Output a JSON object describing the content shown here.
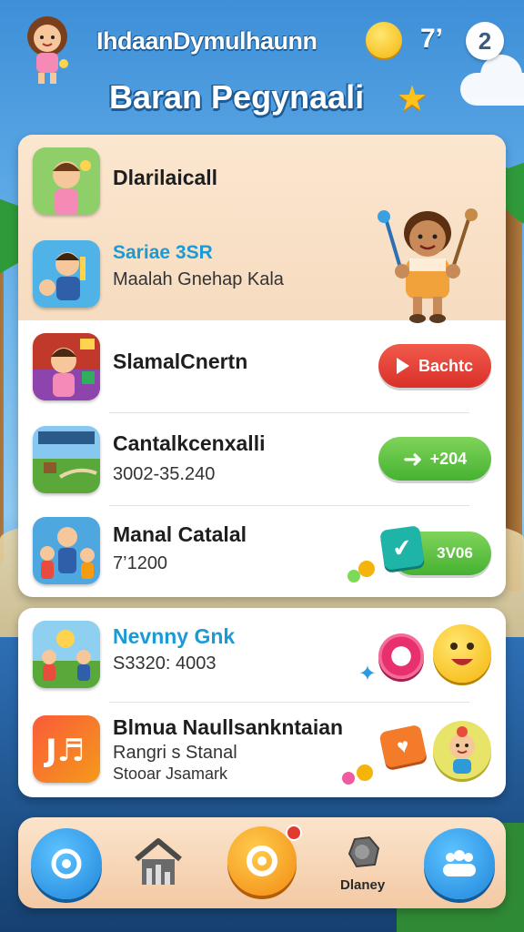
{
  "header": {
    "app_name": "IhdaanDymulhaunn",
    "coin_count": "7’",
    "notification_badge": "2",
    "page_title": "Baran Pegynaali"
  },
  "list": {
    "section_header": {
      "title": "Dlarilaicall"
    },
    "featured": {
      "title": "Sariae 3SR",
      "subtitle": "Maalah Gnehap Kala"
    },
    "items": [
      {
        "title": "SlamalCnertn",
        "subtitle": "",
        "action_label": "Bachtc",
        "action_color": "#e33a30"
      },
      {
        "title": "Cantalkcenxalli",
        "subtitle": "3002-35.240",
        "action_label": "+204",
        "action_color": "#5cc03f"
      },
      {
        "title": "Manal Catalal",
        "subtitle": "7’1200",
        "action_label": "3V06",
        "action_color": "#5cc03f"
      }
    ]
  },
  "list2": {
    "items": [
      {
        "title": "Nevnny Gnk",
        "subtitle": "S3320: 4003"
      },
      {
        "title": "Blmua Naullsankntaian",
        "subtitle": "Rangri s Stanal",
        "subtitle2": "Stooar Jsamark"
      }
    ]
  },
  "nav": {
    "items": [
      {
        "icon": "target-icon"
      },
      {
        "icon": "home-icon"
      },
      {
        "icon": "coin-icon"
      },
      {
        "icon": "stone-icon",
        "label": "Dlaney"
      },
      {
        "icon": "friends-icon"
      }
    ]
  },
  "colors": {
    "sky": "#5aa8e6",
    "accent_blue": "#1a9bd8",
    "play_red": "#e33a30",
    "go_green": "#5cc03f",
    "nav_bg": "#f6d3b0"
  }
}
